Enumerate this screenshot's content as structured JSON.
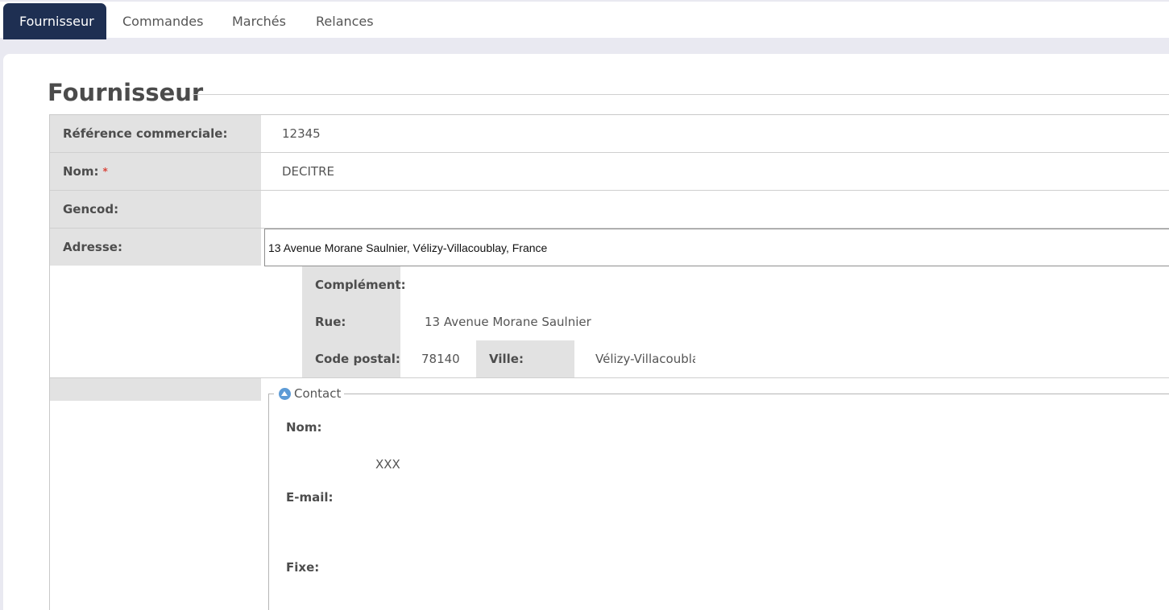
{
  "tabs": [
    {
      "label": "Fournisseur",
      "active": true
    },
    {
      "label": "Commandes",
      "active": false
    },
    {
      "label": "Marchés",
      "active": false
    },
    {
      "label": "Relances",
      "active": false
    }
  ],
  "page_title": "Fournisseur",
  "form": {
    "reference": {
      "label": "Référence commerciale:",
      "value": "12345"
    },
    "nom": {
      "label": "Nom:",
      "required_mark": "*",
      "value": "DECITRE"
    },
    "gencod": {
      "label": "Gencod:",
      "value": ""
    },
    "adresse": {
      "label": "Adresse:",
      "value": "13 Avenue Morane Saulnier, Vélizy-Villacoublay, France",
      "complement": {
        "label": "Complément:",
        "value": ""
      },
      "rue": {
        "label": "Rue:",
        "value": "13 Avenue Morane Saulnier"
      },
      "code_postal": {
        "label": "Code postal:",
        "value": "78140"
      },
      "ville": {
        "label": "Ville:",
        "value": "Vélizy-Villacoubla"
      }
    }
  },
  "contact": {
    "legend": "Contact",
    "legend_icon": "collapse-up-icon",
    "nom": {
      "label": "Nom:",
      "value": "XXX"
    },
    "email": {
      "label": "E-mail:",
      "value": ""
    },
    "fixe": {
      "label": "Fixe:",
      "value": ""
    }
  },
  "colors": {
    "active_tab": "#1e2f52",
    "label_bg": "#e2e2e2",
    "required": "#d9453b",
    "legend_icon": "#5d9bd6"
  }
}
